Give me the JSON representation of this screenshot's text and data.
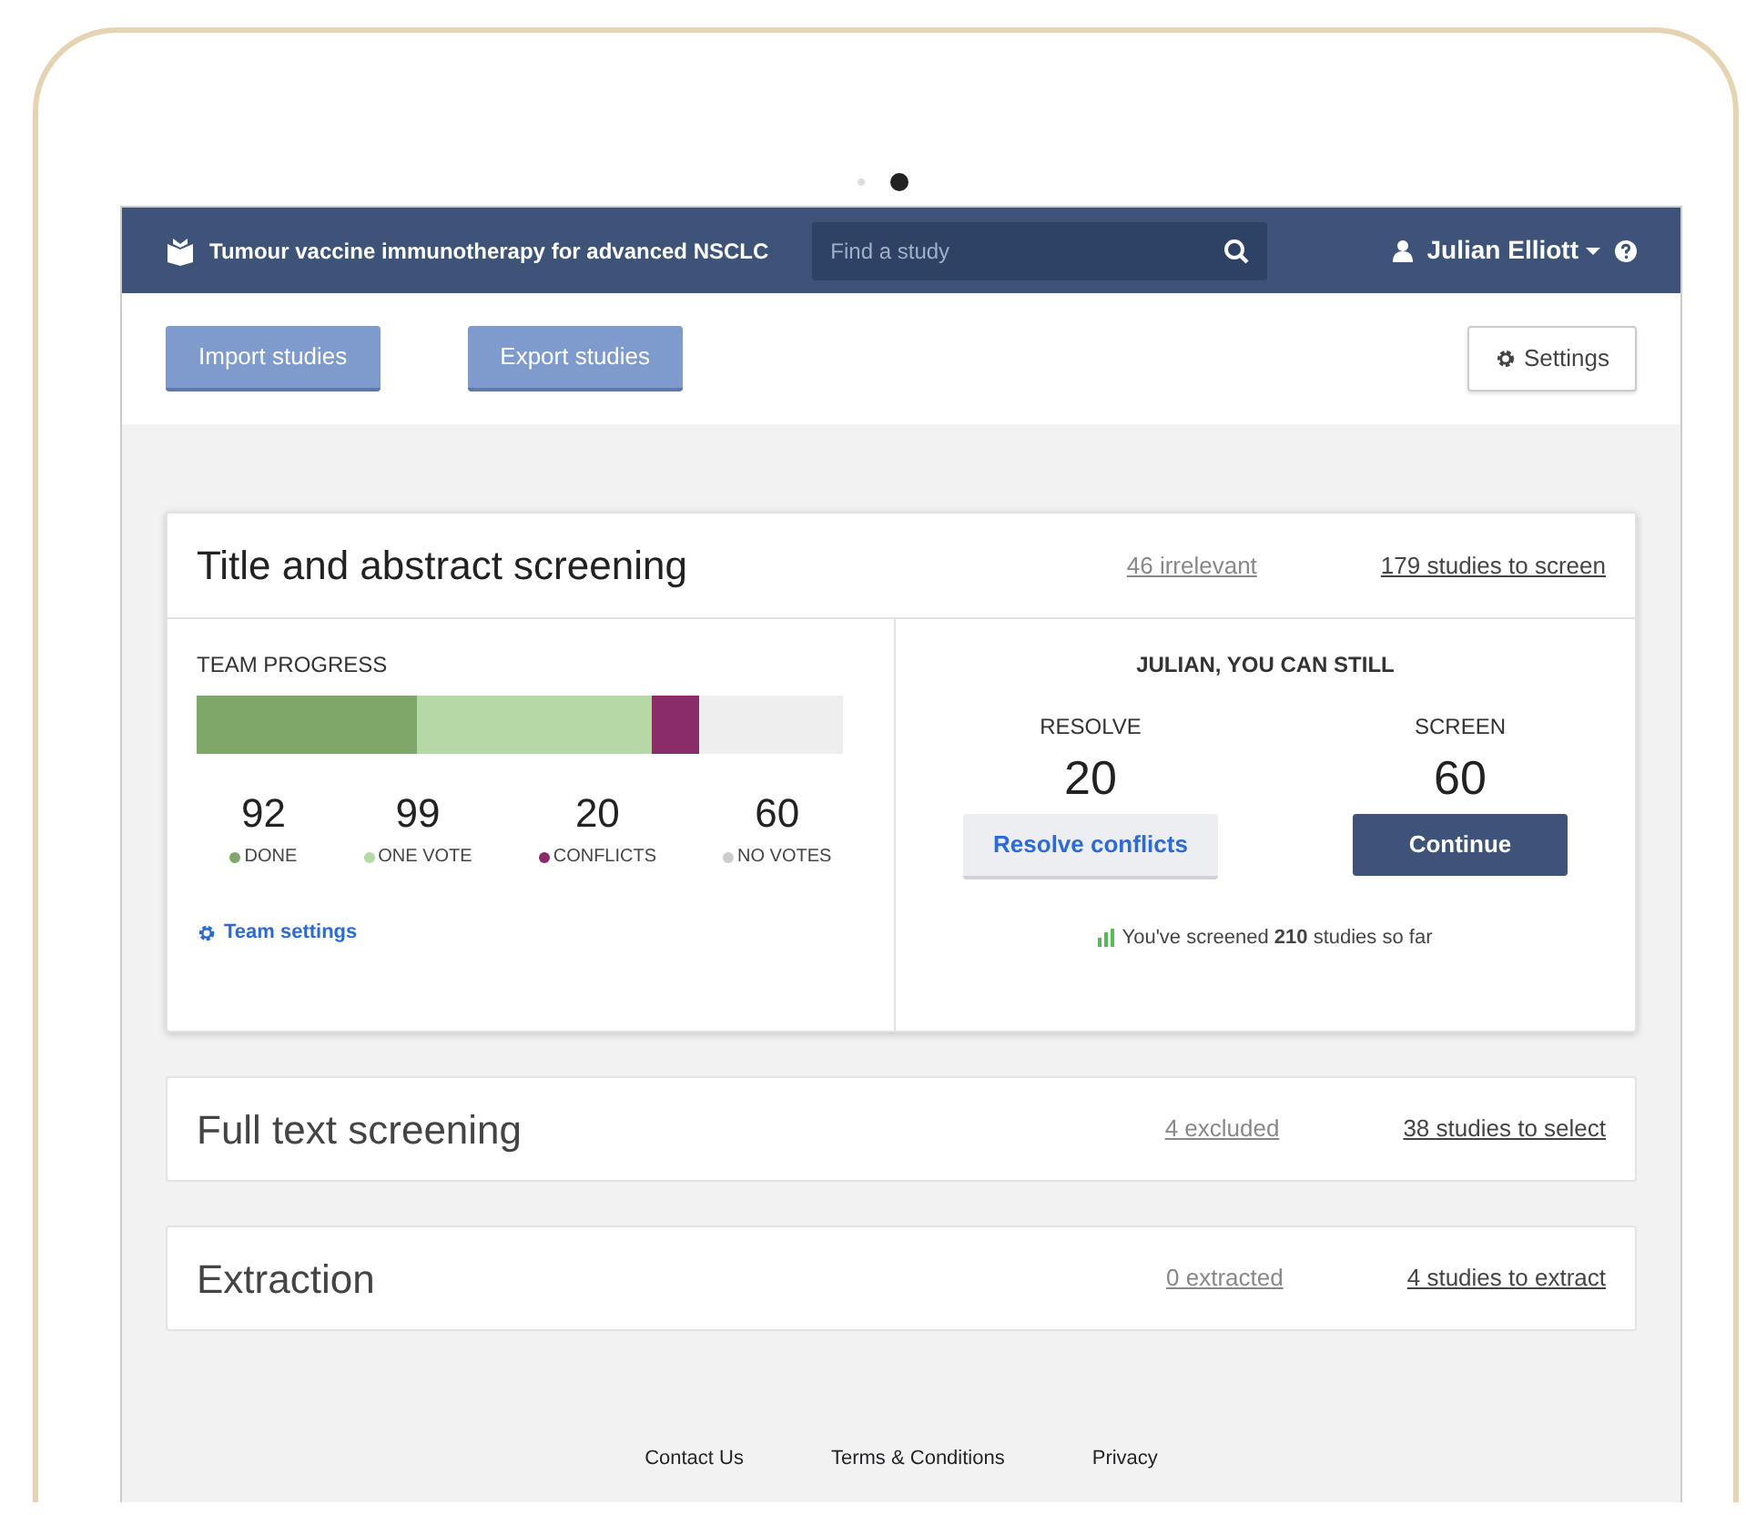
{
  "navbar": {
    "title": "Tumour vaccine immunotherapy for advanced NSCLC",
    "search": {
      "placeholder": "Find a study"
    },
    "user": "Julian Elliott"
  },
  "toolbar": {
    "buttons": [
      "Import studies",
      "Export studies"
    ],
    "settings": "Settings"
  },
  "stages": [
    {
      "title": "Title and abstract screening",
      "expanded": true,
      "links": [
        "46 irrelevant",
        "179 studies to screen"
      ],
      "progress": {
        "heading": "TEAM PROGRESS",
        "segments": [
          {
            "value": "92",
            "label": "DONE",
            "color": "#7fa76a"
          },
          {
            "value": "99",
            "label": "ONE VOTE",
            "color": "#b5d9a6"
          },
          {
            "value": "20",
            "label": "CONFLICTS",
            "color": "#8a2b6a"
          },
          {
            "value": "60",
            "label": "NO VOTES",
            "color": "#cccccc"
          }
        ],
        "team_settings": "Team settings"
      },
      "actions": {
        "heading": "JULIAN, YOU CAN STILL",
        "items": [
          {
            "kind": "secondary",
            "label": "RESOLVE",
            "count": "20",
            "button": "Resolve conflicts"
          },
          {
            "kind": "primary",
            "label": "SCREEN",
            "count": "60",
            "button": "Continue"
          }
        ],
        "summary": "You've screened **210** studies so far"
      }
    },
    {
      "title": "Full text screening",
      "expanded": false,
      "links": [
        "4 excluded",
        "38 studies to select"
      ]
    },
    {
      "title": "Extraction",
      "expanded": false,
      "links": [
        "0 extracted",
        "4 studies to extract"
      ]
    }
  ],
  "footer": [
    "Contact Us",
    "Terms & Conditions",
    "Privacy"
  ]
}
